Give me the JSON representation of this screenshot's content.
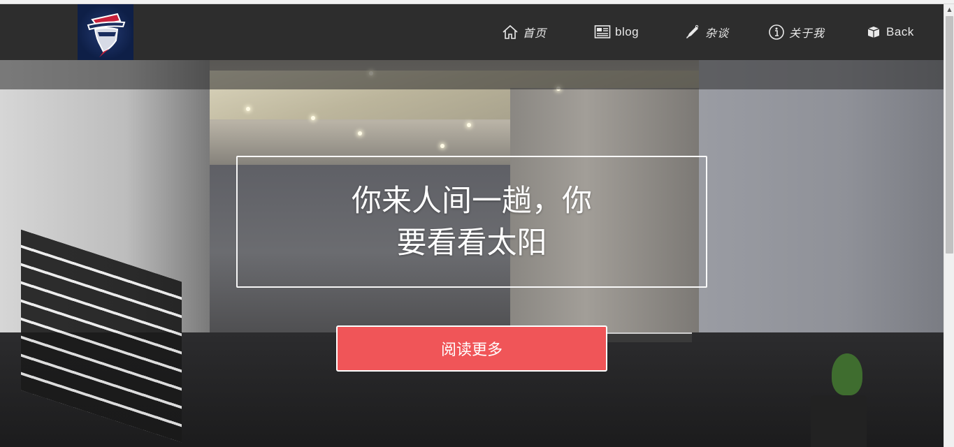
{
  "nav": {
    "items": [
      {
        "label": "首页",
        "icon": "home-icon"
      },
      {
        "label": "blog",
        "icon": "newspaper-icon"
      },
      {
        "label": "杂谈",
        "icon": "pen-icon"
      },
      {
        "label": "关于我",
        "icon": "info-icon"
      },
      {
        "label": "Back",
        "icon": "box-icon"
      }
    ]
  },
  "hero": {
    "headline": "你来人间一趟，你要看看太阳",
    "button_label": "阅读更多"
  },
  "colors": {
    "header_bg": "#2d2d2d",
    "button_bg": "#f05558",
    "logo_bg": "#0e1f47"
  }
}
